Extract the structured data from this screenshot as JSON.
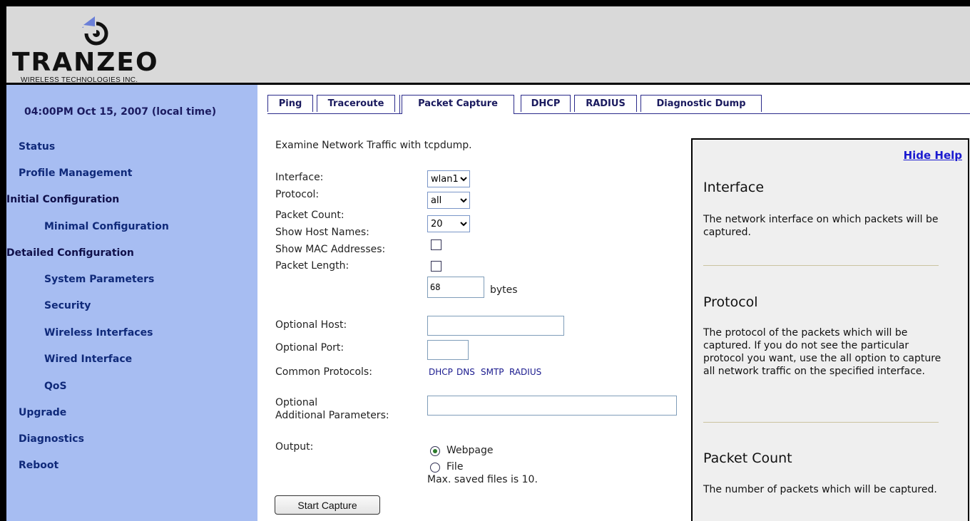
{
  "logo": {
    "wordmark": "TRANZEO",
    "subtitle": "WIRELESS TECHNOLOGIES INC."
  },
  "sidebar": {
    "datetime": "04:00PM Oct 15, 2007 (local time)",
    "items": [
      {
        "label": "Status"
      },
      {
        "label": "Profile Management"
      },
      {
        "label": "Initial Configuration"
      },
      {
        "label": "Minimal Configuration"
      },
      {
        "label": "Detailed Configuration"
      },
      {
        "label": "System Parameters"
      },
      {
        "label": "Security"
      },
      {
        "label": "Wireless Interfaces"
      },
      {
        "label": "Wired Interface"
      },
      {
        "label": "QoS"
      },
      {
        "label": "Upgrade"
      },
      {
        "label": "Diagnostics"
      },
      {
        "label": "Reboot"
      }
    ]
  },
  "tabs": [
    {
      "label": "Ping"
    },
    {
      "label": "Traceroute"
    },
    {
      "label": "Packet Capture"
    },
    {
      "label": "DHCP"
    },
    {
      "label": "RADIUS"
    },
    {
      "label": "Diagnostic Dump"
    }
  ],
  "active_tab": "Packet Capture",
  "form": {
    "intro": "Examine Network Traffic with tcpdump.",
    "interface_label": "Interface:",
    "interface_value": "wlan1",
    "protocol_label": "Protocol:",
    "protocol_value": "all",
    "packet_count_label": "Packet Count:",
    "packet_count_value": "20",
    "show_host_names_label": "Show Host Names:",
    "show_mac_label": "Show MAC Addresses:",
    "packet_length_label": "Packet Length:",
    "packet_length_value": "68",
    "packet_length_unit": "bytes",
    "optional_host_label": "Optional Host:",
    "optional_port_label": "Optional Port:",
    "common_protocols_label": "Common Protocols:",
    "common_protocols": [
      {
        "label": "DHCP"
      },
      {
        "label": "DNS"
      },
      {
        "label": "SMTP"
      },
      {
        "label": "RADIUS"
      }
    ],
    "optional_params_label_1": "Optional",
    "optional_params_label_2": "Additional Parameters:",
    "output_label": "Output:",
    "output_webpage": "Webpage",
    "output_file": "File",
    "max_saved": "Max. saved files is 10.",
    "start_button": "Start Capture"
  },
  "help": {
    "hide_link": "Hide Help",
    "sections": [
      {
        "title": "Interface",
        "text": "The network interface on which packets will be captured."
      },
      {
        "title": "Protocol",
        "text": "The protocol of the packets which will be captured. If you do not see the particular protocol you want, use the all option to capture all network traffic on the specified interface."
      },
      {
        "title": "Packet Count",
        "text": "The number of packets which will be captured."
      }
    ]
  },
  "colors": {
    "sidebar_bg": "#a7bdf2",
    "header_bg": "#d9d9d9",
    "nav_text": "#102a7a",
    "help_bg": "#efefef",
    "link": "#1a1ad0"
  }
}
